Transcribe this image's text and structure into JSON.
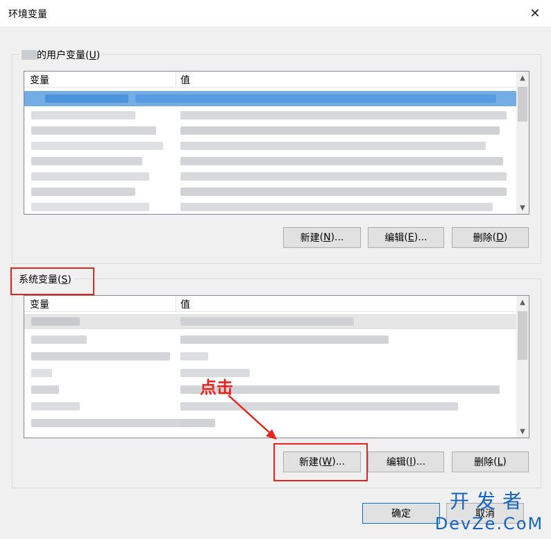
{
  "window": {
    "title": "环境变量",
    "close_glyph": "✕"
  },
  "user_vars": {
    "label_text": "的用户变量",
    "label_hotkey": "U",
    "columns": [
      "变量",
      "值"
    ],
    "buttons": {
      "new": "新建",
      "new_key": "N",
      "edit": "编辑",
      "edit_key": "E",
      "delete": "删除",
      "delete_key": "D"
    }
  },
  "system_vars": {
    "label_text": "系统变量",
    "label_hotkey": "S",
    "columns": [
      "变量",
      "值"
    ],
    "buttons": {
      "new": "新建",
      "new_key": "W",
      "edit": "编辑",
      "edit_key": "I",
      "delete": "删除",
      "delete_key": "L"
    }
  },
  "annotation": {
    "text": "点击",
    "color": "#e8231e"
  },
  "footer": {
    "ok": "确定",
    "cancel": "取消"
  },
  "watermark": {
    "line1": "开发者",
    "line2": "DevZe.CoM"
  },
  "colors": {
    "selection": "#0078d7",
    "highlight_box": "#e8231e",
    "watermark": "#1565c0"
  },
  "icons": {
    "scroll_up": "▲",
    "scroll_down": "▼"
  }
}
